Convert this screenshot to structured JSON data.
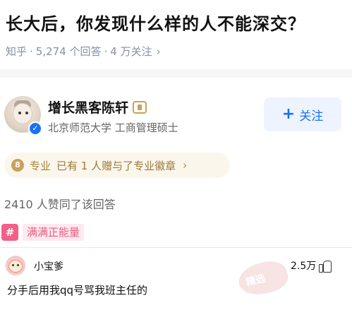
{
  "question": {
    "title": "长大后，你发现什么样的人不能深交？",
    "meta_source": "知乎",
    "meta_answers": "5,274 个回答",
    "meta_followers": "4 万关注",
    "meta_separator": "·",
    "meta_chevron": "›"
  },
  "author": {
    "name": "增长黑客陈轩",
    "description": "北京师范大学 工商管理硕士",
    "avatar_icon": "baby-photo-avatar",
    "verified_icon": "check-badge-icon",
    "verified_glyph": "✓",
    "follow_label": "关注",
    "follow_plus": "+"
  },
  "pro_badge": {
    "label": "专业",
    "text": "已有 1 人赠与了专业徽章",
    "chevron": "›",
    "icon_glyph": "8"
  },
  "agree": {
    "text": "2410 人赞同了该回答"
  },
  "tag": {
    "icon_glyph": "#",
    "label": "满满正能量"
  },
  "comment": {
    "user": "小宝爹",
    "likes": "2.5万",
    "body": "分手后用我qq号骂我班主任的"
  },
  "watermark": {
    "text": "精选"
  },
  "colors": {
    "accent": "#1772f6",
    "gold": "#c8a15a",
    "pink": "#f45f8a",
    "meta_gray": "#8590a6"
  }
}
